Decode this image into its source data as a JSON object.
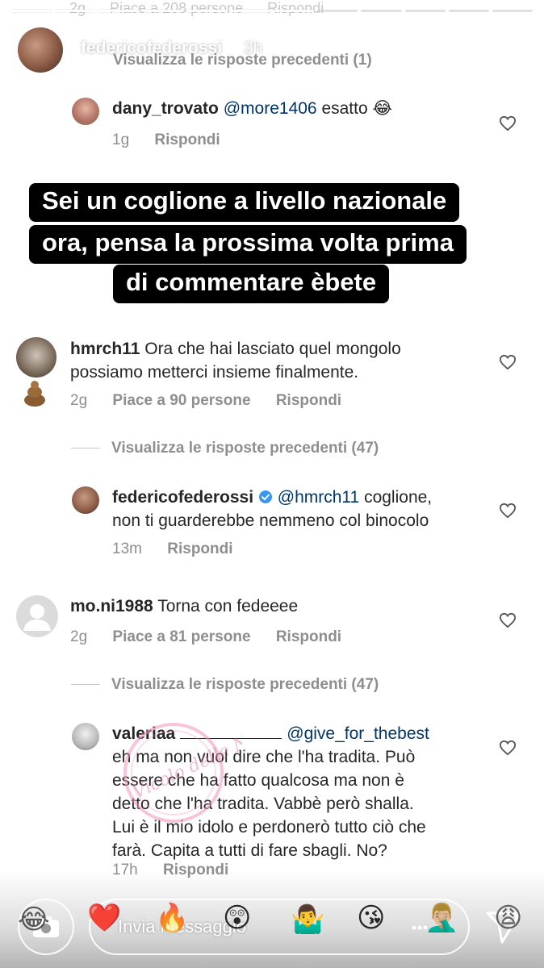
{
  "top_faded": {
    "time": "2g",
    "likes": "Piace a 208 persone",
    "reply": "Rispondi"
  },
  "header": {
    "username": "federicofederossi",
    "time": "2h"
  },
  "thread1": {
    "view_previous": "Visualizza le risposte precedenti (1)",
    "reply": {
      "username": "dany_trovato",
      "mention": "@more1406",
      "text": "esatto 😂",
      "time": "1g",
      "reply_label": "Rispondi"
    }
  },
  "caption": {
    "line1": "Sei un coglione a livello nazionale",
    "line2": "ora, pensa la prossima volta prima",
    "line3": "di commentare èbete"
  },
  "comment_hmrch": {
    "username": "hmrch11",
    "text_line1": "Ora che hai lasciato quel mongolo",
    "text_line2": "possiamo metterci insieme finalmente.",
    "time": "2g",
    "likes": "Piace a 90 persone",
    "reply_label": "Rispondi",
    "view_previous": "Visualizza le risposte precedenti (47)"
  },
  "reply_fede": {
    "username": "federicofederossi",
    "mention": "@hmrch11",
    "text_line1": "coglione,",
    "text_line2": "non ti guarderebbe nemmeno col binocolo",
    "time": "13m",
    "reply_label": "Rispondi"
  },
  "comment_moni": {
    "username": "mo.ni1988",
    "text": "Torna con fedeeee",
    "time": "2g",
    "likes": "Piace a 81 persone",
    "reply_label": "Rispondi",
    "view_previous": "Visualizza le risposte precedenti (47)"
  },
  "reply_valeria": {
    "username": "valeriaa",
    "mention": "@give_for_thebest",
    "lines": [
      "eh ma non vuol dire che l'ha tradita. Può",
      "essere che ha fatto qualcosa ma non è",
      "detto che l'ha tradita. Vabbè però shalla.",
      "Lui è il mio idolo e perdonerò tutto ciò che",
      "farà. Capita a tutti di fare sbagli. No?"
    ],
    "time": "17h",
    "reply_label": "Rispondi"
  },
  "watermark_text": "Vicolo delle News",
  "bottom": {
    "message_placeholder": "Invia messaggio",
    "emojis": [
      "😂",
      "❤️",
      "🔥",
      "😲",
      "🤷‍♂️",
      "😘",
      "🤦🏼‍♂️",
      "😩"
    ]
  }
}
